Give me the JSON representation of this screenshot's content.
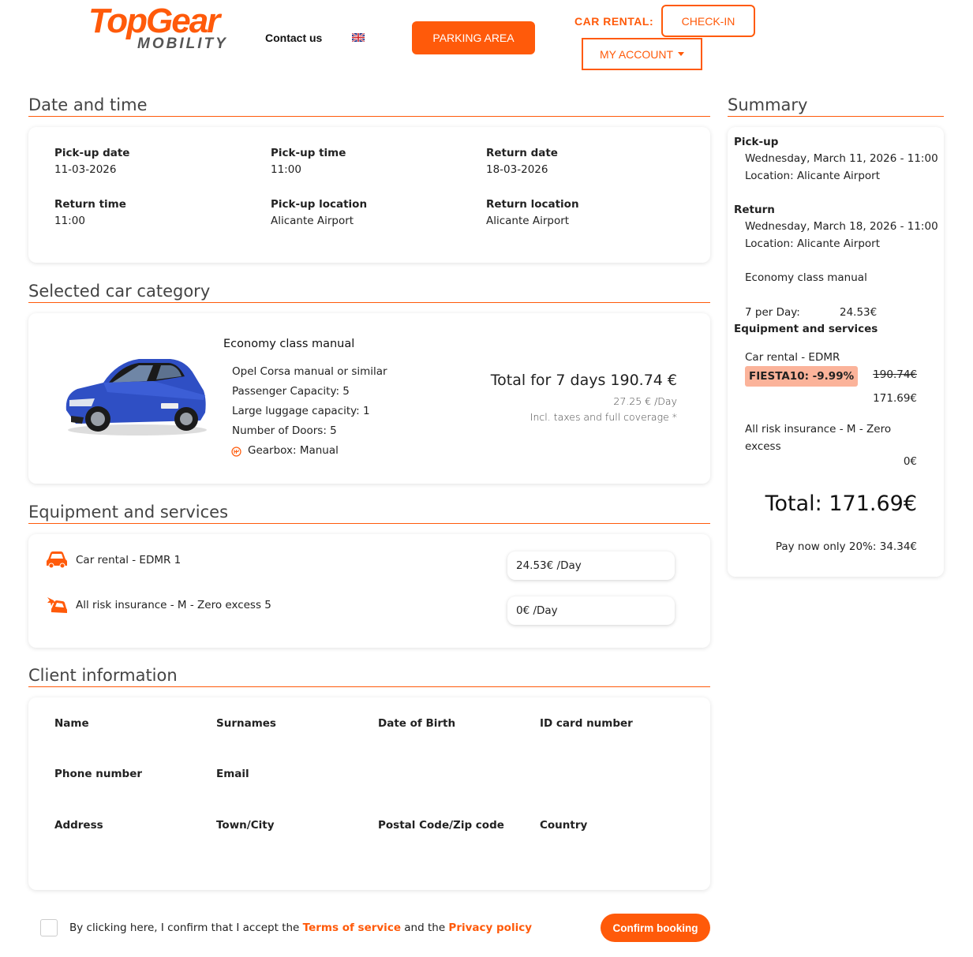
{
  "header": {
    "logo_top": "TopGear",
    "logo_bottom": "MOBILITY",
    "contact": "Contact us",
    "parking": "PARKING AREA",
    "car_rental_label": "CAR RENTAL:",
    "checkin": "CHECK-IN",
    "my_account": "MY ACCOUNT"
  },
  "date_time": {
    "title": "Date and time",
    "fields": [
      {
        "label": "Pick-up date",
        "value": "11-03-2026"
      },
      {
        "label": "Pick-up time",
        "value": "11:00"
      },
      {
        "label": "Return date",
        "value": "18-03-2026"
      },
      {
        "label": "Return time",
        "value": "11:00"
      },
      {
        "label": "Pick-up location",
        "value": "Alicante Airport"
      },
      {
        "label": "Return location",
        "value": "Alicante Airport"
      }
    ]
  },
  "car": {
    "title": "Selected car category",
    "name": "Economy class manual",
    "specs": [
      "Opel Corsa manual or similar",
      "Passenger Capacity: 5",
      "Large luggage capacity: 1",
      "Number of Doors: 5",
      "Gearbox: Manual"
    ],
    "total": "Total for 7 days 190.74 €",
    "per_day": "27.25 € /Day",
    "incl": "Incl. taxes and full coverage *"
  },
  "equipment": {
    "title": "Equipment and services",
    "items": [
      {
        "label": "Car rental - EDMR 1",
        "price": "24.53€ /Day"
      },
      {
        "label": "All risk insurance - M - Zero excess 5",
        "price": "0€ /Day"
      }
    ]
  },
  "client": {
    "title": "Client information",
    "fields": [
      "Name",
      "Surnames",
      "Date of Birth",
      "ID card number",
      "Phone number",
      "Email",
      "Address",
      "Town/City",
      "Postal Code/Zip code",
      "Country"
    ]
  },
  "terms": {
    "pre": "By clicking here, I confirm that I accept the ",
    "tos": "Terms of service",
    "mid": " and the ",
    "privacy": "Privacy policy",
    "confirm": "Confirm booking"
  },
  "summary": {
    "title": "Summary",
    "pickup_label": "Pick-up",
    "pickup_date": "Wednesday, March 11, 2026 - 11:00",
    "pickup_location": "Location: Alicante Airport",
    "return_label": "Return",
    "return_date": "Wednesday, March 18, 2026 - 11:00",
    "return_location": "Location: Alicante Airport",
    "category": "Economy class manual",
    "per_day_label": "7 per Day:",
    "per_day_value": "24.53€",
    "equipment_label": "Equipment and services",
    "rental_label": "Car rental - EDMR",
    "promo": "FIESTA10: -9.99%",
    "old_price": "190.74€",
    "new_price": "171.69€",
    "insurance_label": "All risk insurance - M - Zero excess",
    "insurance_price": "0€",
    "total": "Total: 171.69€",
    "pay_now": "Pay now only 20%: 34.34€"
  },
  "colors": {
    "accent": "#ff5a0a",
    "promo_bg": "#fbb39a",
    "car_blue": "#2f4fc4"
  },
  "icons": {
    "car": "car-icon",
    "insurance": "car-crash-icon",
    "gearbox": "gearbox-icon",
    "flag": "uk-flag-icon"
  }
}
